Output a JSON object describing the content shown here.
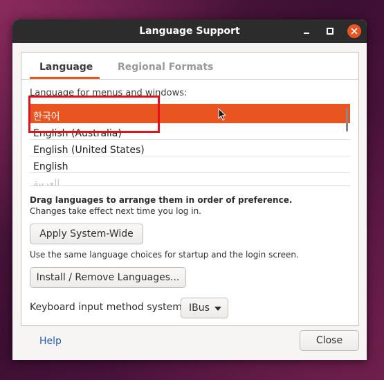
{
  "window": {
    "title": "Language Support"
  },
  "tabs": [
    {
      "label": "Language"
    },
    {
      "label": "Regional Formats"
    }
  ],
  "language_list": {
    "label": "Language for menus and windows:",
    "items": [
      {
        "label": "한국어"
      },
      {
        "label": "English (Australia)"
      },
      {
        "label": "English (United States)"
      },
      {
        "label": "English"
      },
      {
        "label": "العربية"
      }
    ]
  },
  "hints": {
    "drag_bold": "Drag languages to arrange them in order of preference.",
    "drag_note": "Changes take effect next time you log in.",
    "system_wide_note": "Use the same language choices for startup and the login screen."
  },
  "buttons": {
    "apply_system_wide": "Apply System-Wide",
    "install_remove": "Install / Remove Languages...",
    "help": "Help",
    "close": "Close"
  },
  "keyboard_input": {
    "label": "Keyboard input method system:",
    "selected": "IBus"
  },
  "colors": {
    "accent": "#e95420",
    "titlebar": "#2c2c2c",
    "annotation": "#e3111b"
  }
}
